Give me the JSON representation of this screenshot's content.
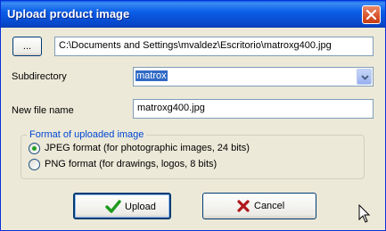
{
  "window": {
    "title": "Upload product image"
  },
  "file": {
    "browse_label": "...",
    "path": "C:\\Documents and Settings\\mvaldez\\Escritorio\\matroxg400.jpg"
  },
  "subdirectory": {
    "label": "Subdirectory",
    "value": "matrox"
  },
  "new_file_name": {
    "label": "New file name",
    "value": "matroxg400.jpg"
  },
  "format": {
    "legend": "Format of uploaded image",
    "options": [
      {
        "label": "JPEG format (for photographic images, 24 bits)",
        "selected": true
      },
      {
        "label": "PNG format (for drawings, logos, 8 bits)",
        "selected": false
      }
    ]
  },
  "actions": {
    "upload_label": "Upload",
    "cancel_label": "Cancel"
  },
  "colors": {
    "titlebar": "#0a5fe8",
    "accent": "#316ac5",
    "legend": "#0046d5"
  },
  "icons": {
    "close": "close-icon",
    "upload": "checkmark-icon",
    "cancel": "x-icon",
    "dropdown": "chevron-down-icon",
    "cursor": "mouse-pointer-icon"
  }
}
